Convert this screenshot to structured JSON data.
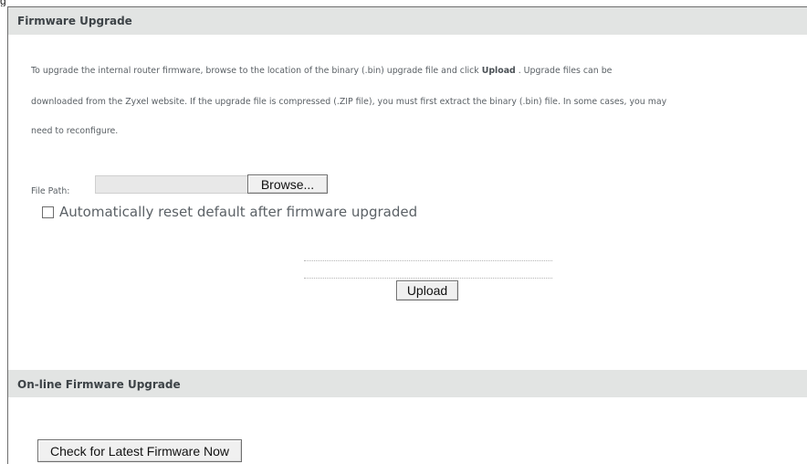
{
  "page_header_fragment": "g",
  "firmware_upgrade": {
    "title": "Firmware Upgrade",
    "description": {
      "line1_before_bold": "To upgrade the internal router firmware, browse to the location of the binary (.bin) upgrade file and click ",
      "line1_bold": "Upload",
      "line1_after_bold": " . Upgrade files can be",
      "line2": "downloaded from the Zyxel website. If the upgrade file is compressed (.ZIP file), you must first extract the binary (.bin) file. In some cases, you may",
      "line3": "need to reconfigure."
    },
    "file_path": {
      "label": "File Path:",
      "value": "",
      "placeholder": ""
    },
    "browse_label": "Browse...",
    "auto_reset": {
      "label": "Automatically reset default after firmware upgraded",
      "checked": false
    },
    "upload_label": "Upload"
  },
  "online_upgrade": {
    "title": "On-line Firmware Upgrade",
    "check_button_label": "Check for Latest Firmware Now"
  },
  "colors": {
    "header_bg": "#e2e4e3",
    "text_gray": "#5b6166",
    "title_text": "#3d4347"
  }
}
